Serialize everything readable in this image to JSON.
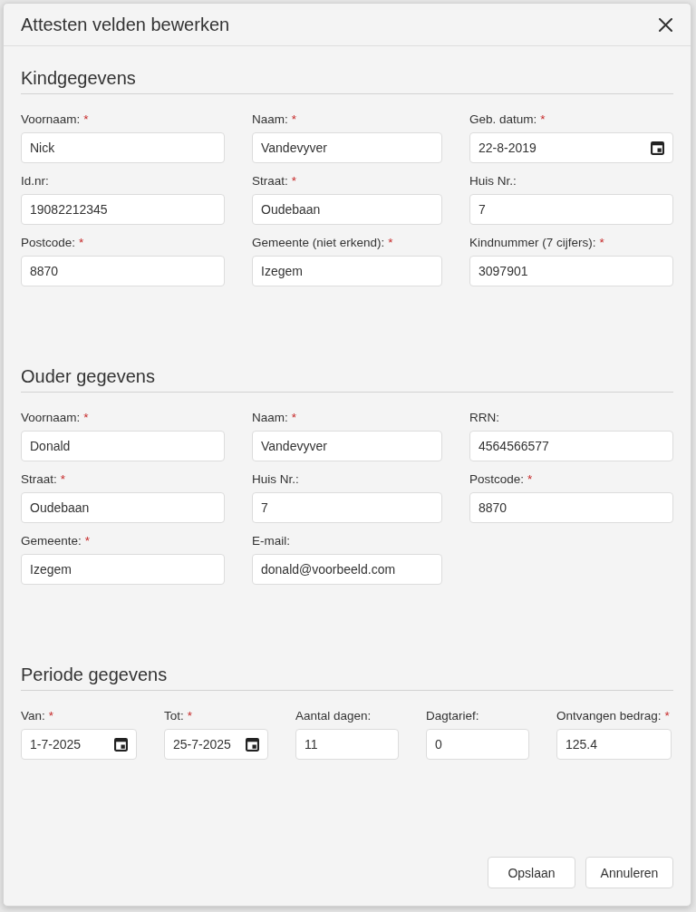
{
  "dialog": {
    "title": "Attesten velden bewerken"
  },
  "sections": [
    {
      "heading": "Kindgegevens",
      "kind": "grid",
      "fields": [
        {
          "label": "Voornaam:",
          "required_mark": "*",
          "value": "Nick",
          "kind": "text"
        },
        {
          "label": "Naam:",
          "required_mark": "*",
          "value": "Vandevyver",
          "kind": "text"
        },
        {
          "label": "Geb. datum:",
          "required_mark": "*",
          "value": "22-8-2019",
          "kind": "date"
        },
        {
          "label": "Id.nr:",
          "value": "19082212345",
          "kind": "text"
        },
        {
          "label": "Straat:",
          "required_mark": "*",
          "value": "Oudebaan",
          "kind": "text"
        },
        {
          "label": "Huis Nr.:",
          "value": "7",
          "kind": "text"
        },
        {
          "label": "Postcode:",
          "required_mark": "*",
          "value": "8870",
          "kind": "text"
        },
        {
          "label": "Gemeente (niet erkend):",
          "required_mark": "*",
          "value": "Izegem",
          "kind": "text"
        },
        {
          "label": "Kindnummer (7 cijfers):",
          "required_mark": "*",
          "value": "3097901",
          "kind": "text"
        }
      ]
    },
    {
      "heading": "Ouder gegevens",
      "kind": "grid",
      "fields": [
        {
          "label": "Voornaam:",
          "required_mark": "*",
          "value": "Donald",
          "kind": "text"
        },
        {
          "label": "Naam:",
          "required_mark": "*",
          "value": "Vandevyver",
          "kind": "text"
        },
        {
          "label": "RRN:",
          "value": "4564566577",
          "kind": "text"
        },
        {
          "label": "Straat:",
          "required_mark": "*",
          "value": "Oudebaan",
          "kind": "text"
        },
        {
          "label": "Huis Nr.:",
          "value": "7",
          "kind": "text"
        },
        {
          "label": "Postcode:",
          "required_mark": "*",
          "value": "8870",
          "kind": "text"
        },
        {
          "label": "Gemeente:",
          "required_mark": "*",
          "value": "Izegem",
          "kind": "text"
        },
        {
          "label": "E-mail:",
          "value": "donald@voorbeeld.com",
          "kind": "text"
        }
      ]
    },
    {
      "heading": "Periode gegevens",
      "kind": "row",
      "fields": [
        {
          "label": "Van:",
          "required_mark": "*",
          "value": "1-7-2025",
          "kind": "date"
        },
        {
          "label": "Tot:",
          "required_mark": "*",
          "value": "25-7-2025",
          "kind": "date"
        },
        {
          "label": "Aantal dagen:",
          "value": "11",
          "kind": "text"
        },
        {
          "label": "Dagtarief:",
          "value": "0",
          "kind": "text"
        },
        {
          "label": "Ontvangen bedrag:",
          "required_mark": "*",
          "value": "125.4",
          "kind": "text"
        }
      ]
    }
  ],
  "buttons": [
    "Opslaan",
    "Annuleren"
  ]
}
